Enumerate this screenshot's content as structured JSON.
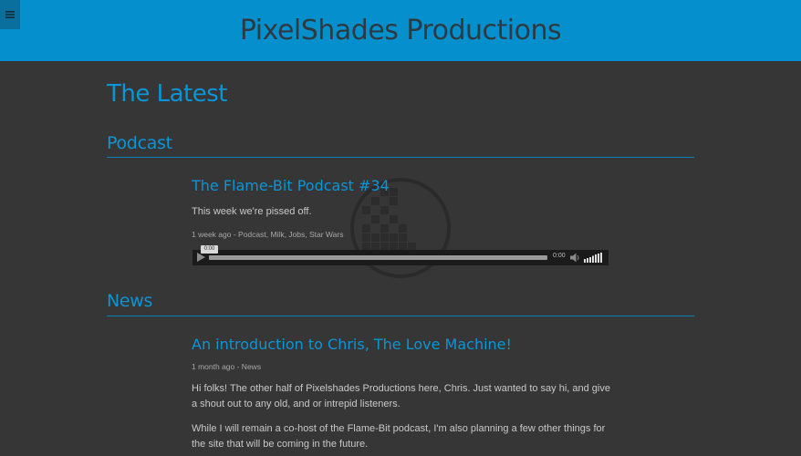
{
  "header": {
    "menu_icon": "hamburger-menu-icon",
    "site_title": "PixelShades Productions",
    "background_color": "#0590cd"
  },
  "main": {
    "page_heading": "The Latest",
    "podcast_section": {
      "heading": "Podcast",
      "post": {
        "title": "The Flame-Bit Podcast #34",
        "body": "This week we're pissed off.",
        "meta": "1 week ago - Podcast, Milk, Jobs, Star Wars"
      },
      "audio_player": {
        "play_icon": "play-icon",
        "current_time_bubble": "0:00",
        "time_display": "0:00",
        "volume_icon": "speaker-icon",
        "progress": 0
      }
    },
    "news_section": {
      "heading": "News",
      "post": {
        "title": "An introduction to Chris, The Love Machine!",
        "meta": "1 month ago - News",
        "paragraphs": [
          "Hi folks! The other half of Pixelshades Productions here, Chris. Just wanted to say hi, and give a shout out to any old, and or intrepid listeners.",
          "While I will remain a co-host of the Flame-Bit podcast, I'm also planning a few other things for the site that will be coming in the future."
        ]
      }
    }
  },
  "colors": {
    "page_background": "#363636",
    "accent": "#0b95d6",
    "body_text": "#c8c8c8"
  }
}
